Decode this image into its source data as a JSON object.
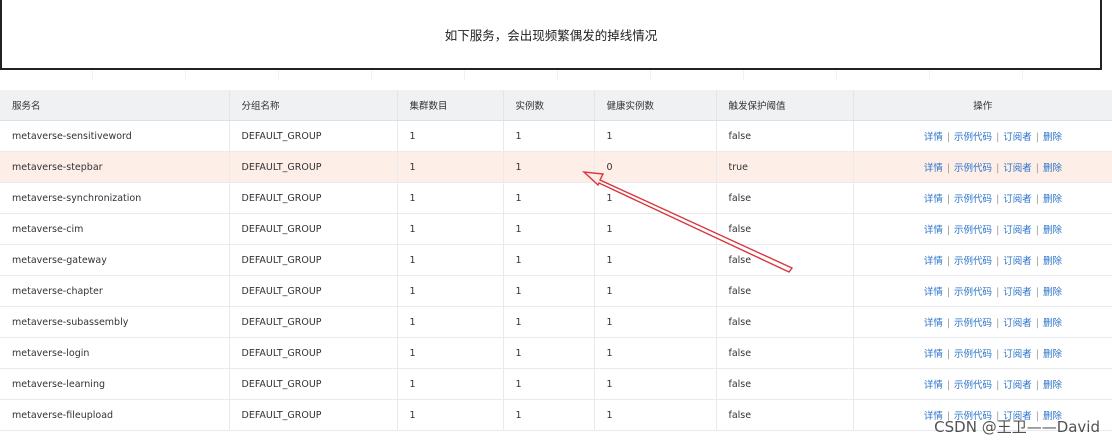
{
  "note": {
    "text": "如下服务，会出现频繁偶发的掉线情况"
  },
  "table": {
    "headers": [
      "服务名",
      "分组名称",
      "集群数目",
      "实例数",
      "健康实例数",
      "触发保护阈值",
      "操作"
    ],
    "actions": {
      "detail": "详情",
      "sample_code": "示例代码",
      "subscribers": "订阅者",
      "delete": "删除",
      "separator": "|"
    },
    "rows": [
      {
        "service": "metaverse-sensitiveword",
        "group": "DEFAULT_GROUP",
        "clusters": "1",
        "instances": "1",
        "healthy": "1",
        "protect": "false"
      },
      {
        "service": "metaverse-stepbar",
        "group": "DEFAULT_GROUP",
        "clusters": "1",
        "instances": "1",
        "healthy": "0",
        "protect": "true"
      },
      {
        "service": "metaverse-synchronization",
        "group": "DEFAULT_GROUP",
        "clusters": "1",
        "instances": "1",
        "healthy": "1",
        "protect": "false"
      },
      {
        "service": "metaverse-cim",
        "group": "DEFAULT_GROUP",
        "clusters": "1",
        "instances": "1",
        "healthy": "1",
        "protect": "false"
      },
      {
        "service": "metaverse-gateway",
        "group": "DEFAULT_GROUP",
        "clusters": "1",
        "instances": "1",
        "healthy": "1",
        "protect": "false"
      },
      {
        "service": "metaverse-chapter",
        "group": "DEFAULT_GROUP",
        "clusters": "1",
        "instances": "1",
        "healthy": "1",
        "protect": "false"
      },
      {
        "service": "metaverse-subassembly",
        "group": "DEFAULT_GROUP",
        "clusters": "1",
        "instances": "1",
        "healthy": "1",
        "protect": "false"
      },
      {
        "service": "metaverse-login",
        "group": "DEFAULT_GROUP",
        "clusters": "1",
        "instances": "1",
        "healthy": "1",
        "protect": "false"
      },
      {
        "service": "metaverse-learning",
        "group": "DEFAULT_GROUP",
        "clusters": "1",
        "instances": "1",
        "healthy": "1",
        "protect": "false"
      },
      {
        "service": "metaverse-fileupload",
        "group": "DEFAULT_GROUP",
        "clusters": "1",
        "instances": "1",
        "healthy": "1",
        "protect": "false"
      }
    ],
    "highlight_color": "#fdeee8",
    "link_color": "#2a73c9"
  },
  "annotation": {
    "arrow_color": "#d9363e"
  },
  "watermark": "CSDN @王卫——David"
}
